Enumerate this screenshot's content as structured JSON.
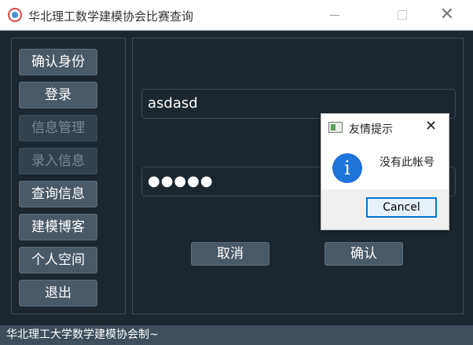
{
  "window": {
    "title": "华北理工数学建模协会比赛查询",
    "minimize_glyph": "—",
    "maximize_glyph": "☐",
    "close_glyph": "✕"
  },
  "sidebar": {
    "items": [
      {
        "label": "确认身份",
        "enabled": true
      },
      {
        "label": "登录",
        "enabled": true
      },
      {
        "label": "信息管理",
        "enabled": false
      },
      {
        "label": "录入信息",
        "enabled": false
      },
      {
        "label": "查询信息",
        "enabled": true
      },
      {
        "label": "建模博客",
        "enabled": true
      },
      {
        "label": "个人空间",
        "enabled": true
      },
      {
        "label": "退出",
        "enabled": true
      }
    ]
  },
  "form": {
    "username_value": "asdasd",
    "password_value": "●●●●●",
    "cancel_label": "取消",
    "confirm_label": "确认"
  },
  "status_bar": {
    "text": "华北理工大学数学建模协会制~"
  },
  "dialog": {
    "title": "友情提示",
    "close_glyph": "✕",
    "info_glyph": "i",
    "message": "没有此帐号",
    "button_label": "Cancel"
  },
  "colors": {
    "background": "#1b262e",
    "button": "#4a5966",
    "button_disabled": "#34424d",
    "status_bar": "#3f4e5a",
    "info_blue": "#1d73d8",
    "focus_border": "#0078d7"
  }
}
